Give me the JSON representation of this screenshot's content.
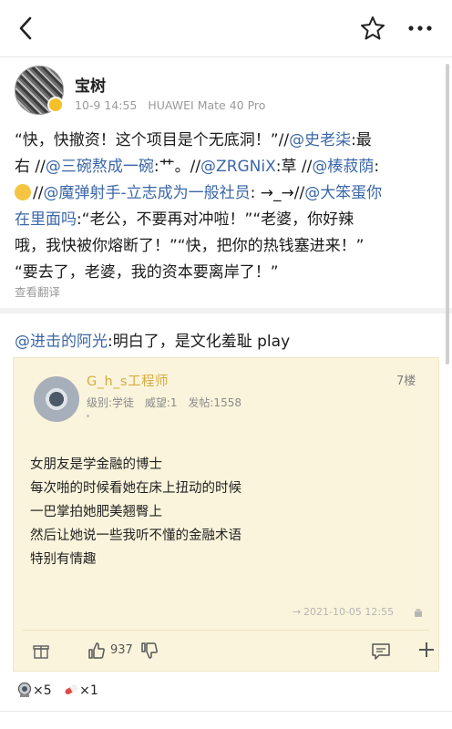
{
  "nav": {
    "back_icon": "chevron-left-icon",
    "star_icon": "star-outline-icon",
    "more_icon": "more-dots-icon"
  },
  "user": {
    "name": "宝树",
    "date": "10-9 14:55",
    "device": "HUAWEI Mate 40 Pro",
    "badge_color": "#f6c02a"
  },
  "post": {
    "line1": "“快，快撤资！这个项目是个无底洞！”//",
    "mention1": "@史老柒",
    "text1": ":最",
    "line2_a": "右 //",
    "mention2": "@三碗熬成一碗",
    "text2": ":艹。//",
    "mention3": "@ZRGNiX",
    "text3": ":草 //",
    "mention4": "@楱菽荫",
    "text4": ":",
    "line3_a": "//",
    "mention5": "@魔弹射手-立志成为一般社员",
    "text5": ": →_→//",
    "mention6": "@大笨蛋你",
    "line4_mention": "在里面吗",
    "text6": ":“老公，不要再对冲啦！”“老婆，你好辣",
    "line5": "哦，我快被你熔断了！”“快，把你的热钱塞进来！”",
    "line6": "“要去了，老婆，我的资本要离岸了！”",
    "translate": "查看翻译"
  },
  "reply": {
    "mention": "@进击的阿光",
    "text": ":明白了，是文化羞耻 play"
  },
  "card": {
    "name": "G_h_s工程师",
    "floor": "7楼",
    "level": "级别:学徒",
    "prestige": "威望:1",
    "posts": "发帖:1558",
    "lines": [
      "女朋友是学金融的博士",
      "每次啪的时候看她在床上扭动的时候",
      "一巴掌拍她肥美翘臀上",
      "然后让她说一些我听不懂的金融术语",
      "特别有情趣"
    ],
    "arrow": "→",
    "time": "2021-10-05 12:55",
    "like_count": "937",
    "icons": [
      "gift-icon",
      "thumb-up-icon",
      "thumb-down-icon",
      "comment-icon",
      "plus-icon",
      "android-icon"
    ]
  },
  "badges": {
    "diver_count": "×5",
    "pill_count": "×1"
  },
  "colors": {
    "mention": "#3b67a8",
    "card_bg": "#fbf4dc",
    "card_name": "#d4ac3f"
  }
}
